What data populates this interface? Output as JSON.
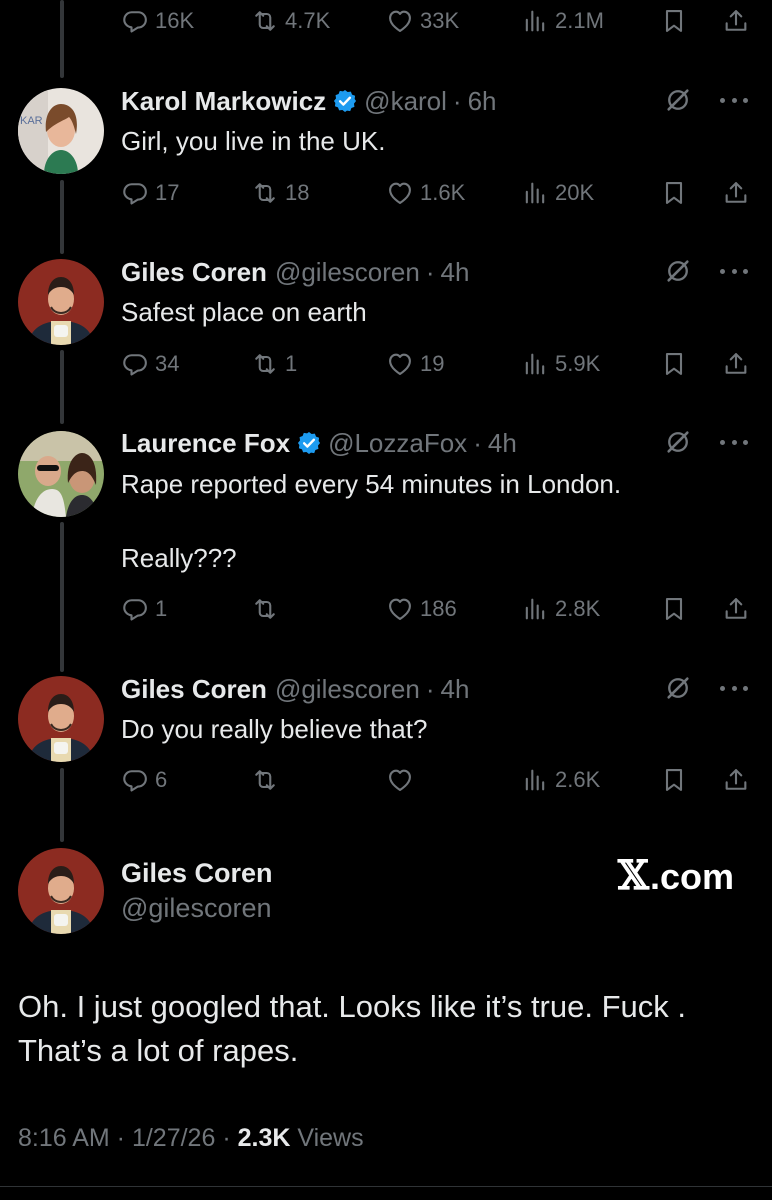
{
  "colors": {
    "background": "#000000",
    "text": "#e7e9ea",
    "muted": "#71767b",
    "verified": "#1d9bf0",
    "thread_line": "#333639"
  },
  "top_actions": {
    "replies": "16K",
    "reposts": "4.7K",
    "likes": "33K",
    "views": "2.1M"
  },
  "replies": [
    {
      "name": "Karol Markowicz",
      "verified": true,
      "handle": "@karol",
      "time": "6h",
      "text": "Girl, you live in the UK.",
      "stats": {
        "replies": "17",
        "reposts": "18",
        "likes": "1.6K",
        "views": "20K"
      }
    },
    {
      "name": "Giles Coren",
      "verified": false,
      "handle": "@gilescoren",
      "time": "4h",
      "text": "Safest place on earth",
      "stats": {
        "replies": "34",
        "reposts": "1",
        "likes": "19",
        "views": "5.9K"
      }
    },
    {
      "name": "Laurence Fox",
      "verified": true,
      "handle": "@LozzaFox",
      "time": "4h",
      "text": "Rape reported every 54 minutes in London.\n\nReally???",
      "stats": {
        "replies": "1",
        "reposts": "",
        "likes": "186",
        "views": "2.8K"
      }
    },
    {
      "name": "Giles Coren",
      "verified": false,
      "handle": "@gilescoren",
      "time": "4h",
      "text": "Do you really believe that?",
      "stats": {
        "replies": "6",
        "reposts": "",
        "likes": "",
        "views": "2.6K"
      }
    }
  ],
  "main_post": {
    "name": "Giles Coren",
    "handle": "@gilescoren",
    "text": "Oh. I just googled that. Looks like it’s true. Fuck .\nThat’s a lot of rapes.",
    "time": "8:16 AM",
    "date": "1/27/26",
    "views_count": "2.3K",
    "views_label": "Views"
  },
  "watermark": {
    "x": "𝕏",
    "suffix": ".com"
  },
  "icons": [
    "reply-icon",
    "repost-icon",
    "like-icon",
    "views-icon",
    "bookmark-icon",
    "share-icon",
    "grok-icon",
    "more-icon",
    "verified-badge-icon"
  ]
}
